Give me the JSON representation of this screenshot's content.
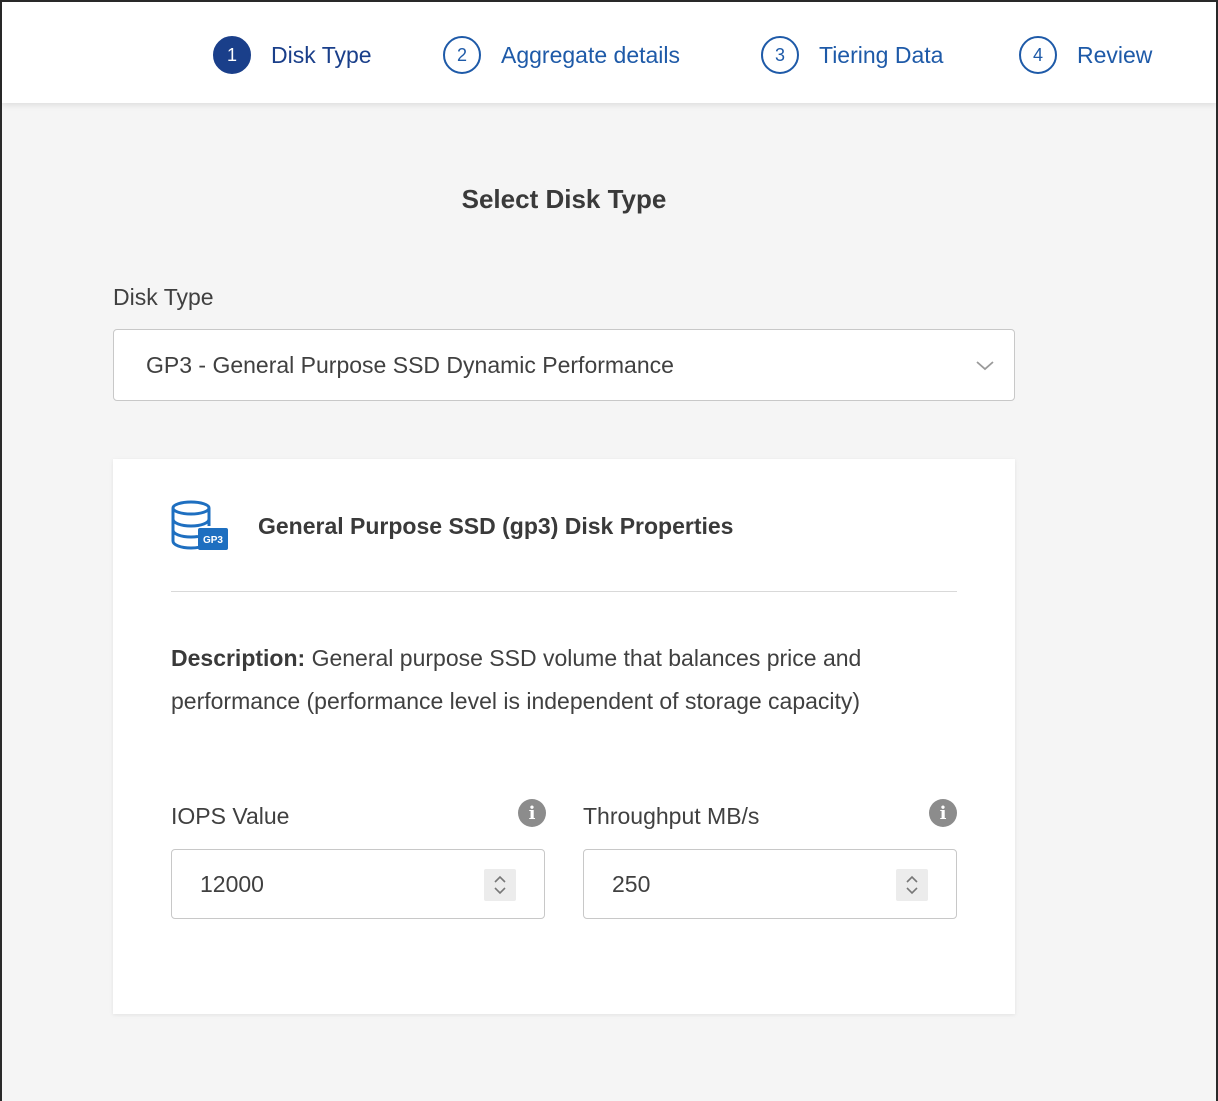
{
  "stepper": {
    "steps": [
      {
        "num": "1",
        "label": "Disk Type"
      },
      {
        "num": "2",
        "label": "Aggregate details"
      },
      {
        "num": "3",
        "label": "Tiering Data"
      },
      {
        "num": "4",
        "label": "Review"
      }
    ],
    "active_step": 1
  },
  "page": {
    "title": "Select Disk Type"
  },
  "disk_type": {
    "label": "Disk Type",
    "selected": "GP3 - General Purpose SSD Dynamic Performance"
  },
  "properties": {
    "icon_badge": "GP3",
    "title": "General Purpose SSD (gp3) Disk Properties",
    "description_label": "Description:",
    "description_text": " General purpose SSD volume that balances price and performance (performance level is independent of storage capacity)",
    "iops": {
      "label": "IOPS Value",
      "value": "12000"
    },
    "throughput": {
      "label": "Throughput MB/s",
      "value": "250"
    }
  },
  "colors": {
    "accent": "#1a3f8a",
    "link": "#1e5aa8",
    "background": "#f5f5f5"
  }
}
